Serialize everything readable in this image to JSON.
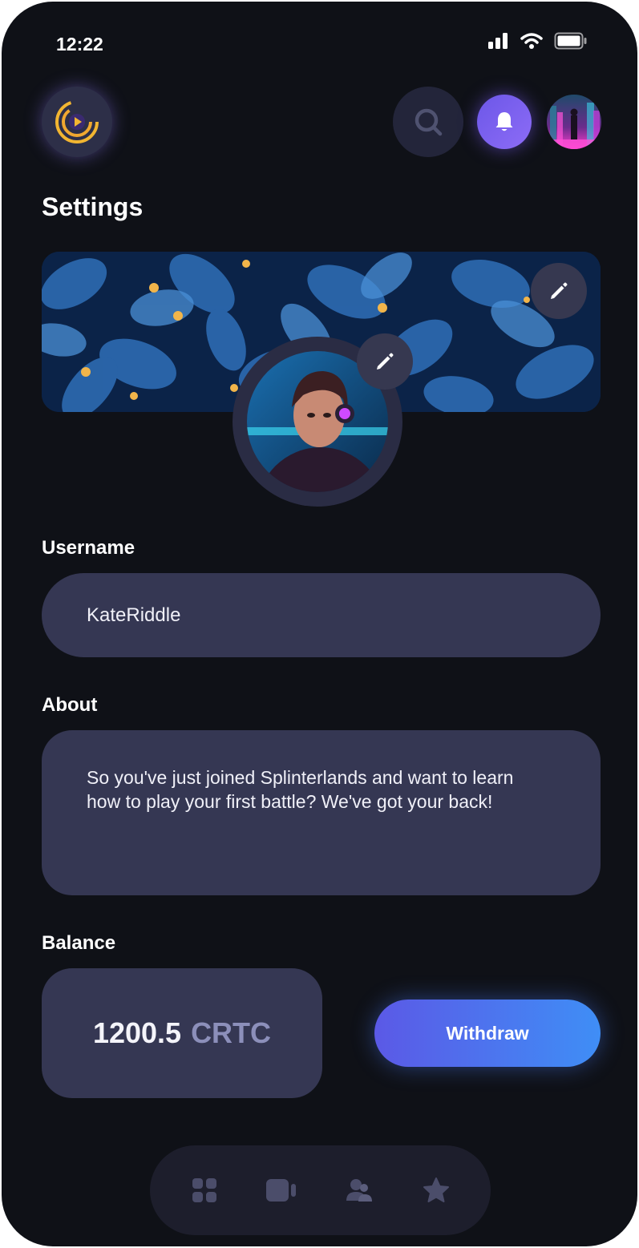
{
  "status_bar": {
    "time": "12:22"
  },
  "header": {
    "title": "Settings"
  },
  "profile": {
    "username_label": "Username",
    "username_value": "KateRiddle",
    "about_label": "About",
    "about_value": "So you've just joined Splinterlands and want to learn how to play your first battle? We've got your back!"
  },
  "balance": {
    "label": "Balance",
    "amount": "1200.5",
    "currency": "CRTC",
    "withdraw_label": "Withdraw"
  },
  "icons": {
    "logo": "play-logo-icon",
    "search": "search-icon",
    "notifications": "bell-icon",
    "cover_edit": "pencil-icon",
    "avatar_edit": "pencil-icon",
    "nav": [
      "grid-icon",
      "video-icon",
      "users-icon",
      "star-icon"
    ]
  },
  "colors": {
    "background": "#0f1117",
    "surface": "#353753",
    "accent_purple": "#7a62f0",
    "accent_blue": "#3f8ef6",
    "logo_gold": "#f2b531"
  }
}
